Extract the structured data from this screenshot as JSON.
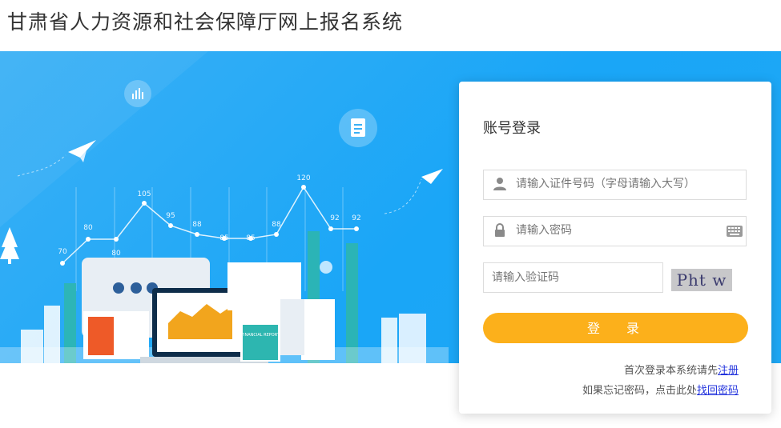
{
  "header": {
    "title": "甘肃省人力资源和社会保障厅网上报名系统"
  },
  "login": {
    "title": "账号登录",
    "id_placeholder": "请输入证件号码（字母请输入大写）",
    "password_placeholder": "请输入密码",
    "captcha_placeholder": "请输入验证码",
    "captcha_text": "Pht w",
    "login_button": "登 录",
    "register_prompt": "首次登录本系统请先",
    "register_link": "注册",
    "forgot_prompt": "如果忘记密码，点击此处",
    "forgot_link": "找回密码"
  },
  "illustration": {
    "chart_values": [
      "70",
      "80",
      "80",
      "105",
      "95",
      "88",
      "85",
      "85",
      "88",
      "120",
      "92",
      "92"
    ],
    "report_label": "FINANCIAL REPORT"
  },
  "colors": {
    "banner": "#1aa6f7",
    "button": "#fcb01b",
    "link": "#2233dd"
  }
}
